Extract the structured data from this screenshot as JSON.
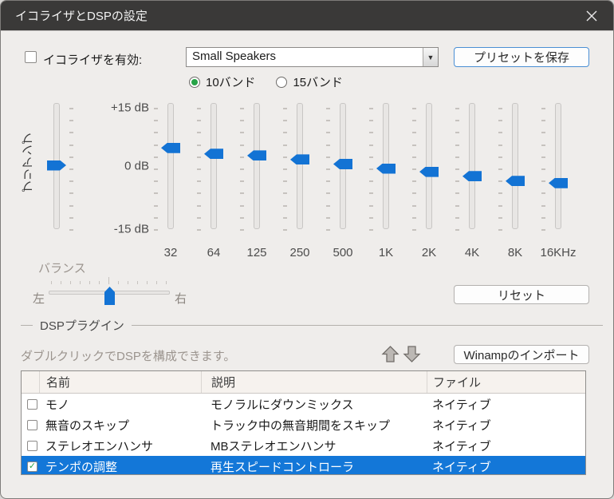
{
  "window": {
    "title": "イコライザとDSPの設定",
    "icons": {
      "close": "close-x",
      "dropdown": "▼",
      "checkmark": "✓",
      "move_up": "block-arrow-up",
      "move_down": "block-arrow-down"
    }
  },
  "equalizer": {
    "enable_label": "イコライザを有効:",
    "enabled": false,
    "preset_value": "Small Speakers",
    "save_preset_button": "プリセットを保存",
    "band_options": [
      {
        "key": "10-band",
        "label": "10バンド",
        "selected": true
      },
      {
        "key": "15-band",
        "label": "15バンド",
        "selected": false
      }
    ],
    "scale_labels": [
      "+15 dB",
      "0 dB",
      "-15 dB"
    ],
    "preamp": {
      "label": "プリアンプ",
      "db": 0
    },
    "bands": [
      {
        "label": "32",
        "db": 4.3
      },
      {
        "label": "64",
        "db": 2.8
      },
      {
        "label": "125",
        "db": 2.4
      },
      {
        "label": "250",
        "db": 1.4
      },
      {
        "label": "500",
        "db": 0.3
      },
      {
        "label": "1K",
        "db": -0.8
      },
      {
        "label": "2K",
        "db": -1.6
      },
      {
        "label": "4K",
        "db": -2.7
      },
      {
        "label": "8K",
        "db": -3.9
      },
      {
        "label": "16KHz",
        "db": -4.4
      }
    ],
    "balance": {
      "label": "バランス",
      "left_label": "左",
      "right_label": "右",
      "value": 0
    },
    "reset_button": "リセット"
  },
  "dsp": {
    "section_title": "DSPプラグイン",
    "hint": "ダブルクリックでDSPを構成できます。",
    "winamp_import_button": "Winampのインポート",
    "table": {
      "columns": [
        "名前",
        "説明",
        "ファイル"
      ],
      "rows": [
        {
          "checked": false,
          "selected": false,
          "name": "モノ",
          "description": "モノラルにダウンミックス",
          "file": "ネイティブ"
        },
        {
          "checked": false,
          "selected": false,
          "name": "無音のスキップ",
          "description": "トラック中の無音期間をスキップ",
          "file": "ネイティブ"
        },
        {
          "checked": false,
          "selected": false,
          "name": "ステレオエンハンサ",
          "description": "MBステレオエンハンサ",
          "file": "ネイティブ"
        },
        {
          "checked": true,
          "selected": true,
          "name": "テンポの調整",
          "description": "再生スピードコントローラ",
          "file": "ネイティブ"
        }
      ]
    }
  },
  "colors": {
    "accent_blue": "#1373d4",
    "selection_blue": "#1377d8",
    "check_green": "#27a347",
    "titlebar": "#3a3938",
    "body_bg": "#efedeb"
  }
}
